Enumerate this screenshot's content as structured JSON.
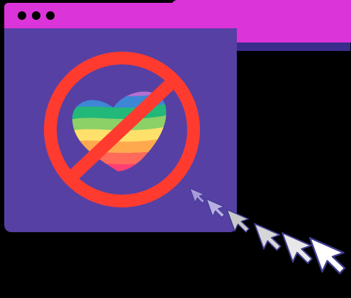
{
  "illustration": {
    "window_colors": {
      "title_bar": "#DB34D9",
      "body": "#5640A3",
      "title_dot": "#000000"
    },
    "title_bar_dot_count": 3,
    "prohibition_sign": {
      "icon": "no-symbol-icon",
      "color": "#FF3B2F",
      "subject": "rainbow-heart-icon"
    },
    "rainbow_heart_stripes": [
      "#B66FD0",
      "#3E86D6",
      "#22B87A",
      "#8BD168",
      "#FFE06B",
      "#FFA94F",
      "#FF6A5A",
      "#FF3F73"
    ],
    "cursor_trail": {
      "icon": "mouse-cursor-icon",
      "count": 6,
      "fill_colors": [
        "#A99ADB",
        "#B8AEE3",
        "#C8C8C8",
        "#D6D6D6",
        "#E8E8E8",
        "#FFFFFF"
      ],
      "outline_color": "#3F3D8F"
    },
    "back_window": {
      "color": "#DB34D9",
      "shadow": "#3A2C8C"
    }
  }
}
